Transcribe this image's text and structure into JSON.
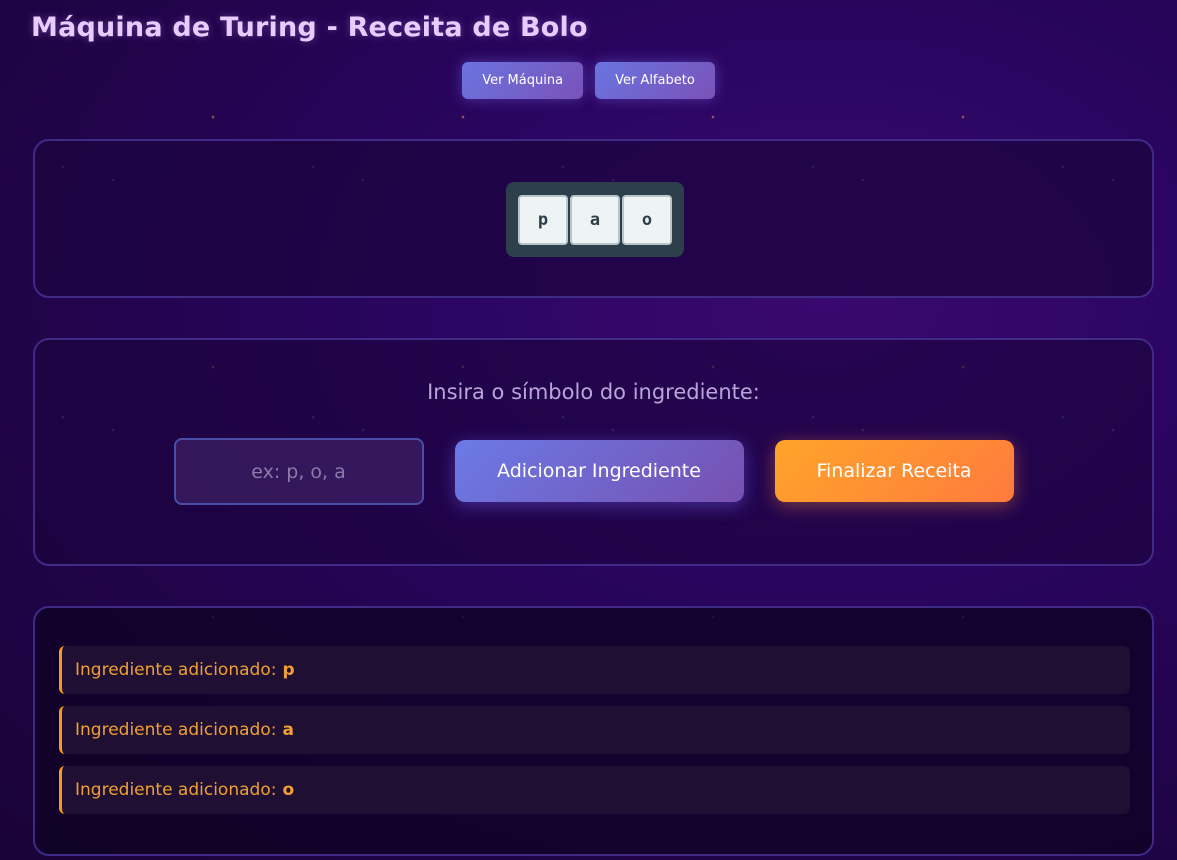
{
  "page": {
    "title": "Máquina de Turing - Receita de Bolo"
  },
  "nav": {
    "buttons": [
      {
        "label": "Ver Máquina"
      },
      {
        "label": "Ver Alfabeto"
      }
    ]
  },
  "tape": {
    "cells": [
      "p",
      "a",
      "o"
    ]
  },
  "input_panel": {
    "prompt": "Insira o símbolo do ingrediente:",
    "input": {
      "value": "",
      "placeholder": "ex: p, o, a"
    },
    "add_button": "Adicionar Ingrediente",
    "finish_button": "Finalizar Receita"
  },
  "log": {
    "entries": [
      {
        "text": "Ingrediente adicionado:",
        "symbol": "p"
      },
      {
        "text": "Ingrediente adicionado:",
        "symbol": "a"
      },
      {
        "text": "Ingrediente adicionado:",
        "symbol": "o"
      }
    ]
  },
  "colors": {
    "accent_purple": "#6b7ae6",
    "accent_orange": "#ff8a34",
    "log_text": "#f0a032",
    "tape_bg": "#2c3f4a"
  }
}
